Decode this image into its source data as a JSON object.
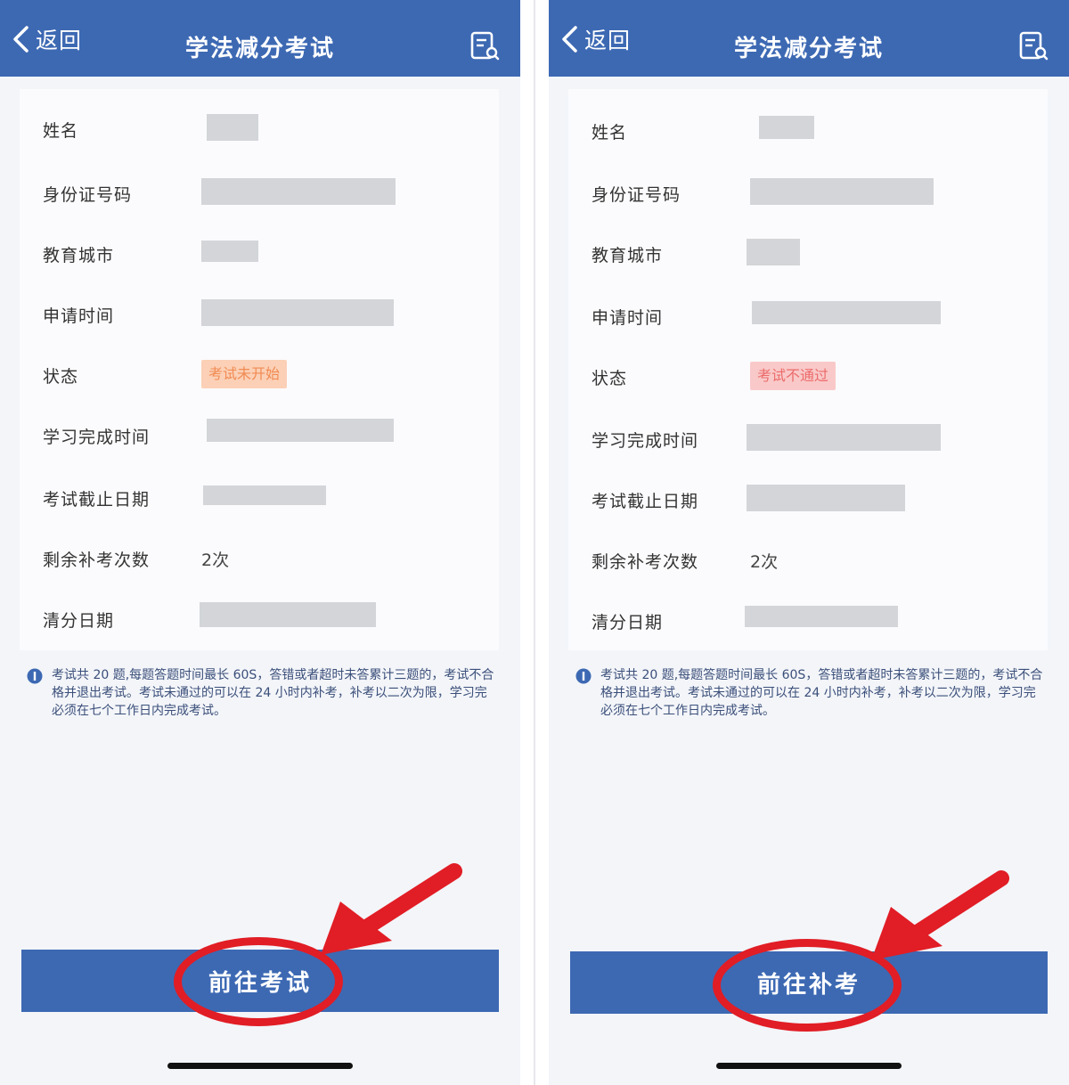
{
  "screens": [
    {
      "nav": {
        "back_label": "返回",
        "title": "学法减分考试",
        "action_icon": "document-search-icon"
      },
      "fields": {
        "name": {
          "label": "姓名"
        },
        "id_number": {
          "label": "身份证号码"
        },
        "city": {
          "label": "教育城市"
        },
        "apply_time": {
          "label": "申请时间"
        },
        "status": {
          "label": "状态",
          "value": "考试未开始",
          "bg": "#fbd0b6",
          "fg": "#f18b53"
        },
        "study_done_time": {
          "label": "学习完成时间"
        },
        "exam_deadline": {
          "label": "考试截止日期"
        },
        "remaining_makeup": {
          "label": "剩余补考次数",
          "value": "2次"
        },
        "clear_date": {
          "label": "清分日期"
        }
      },
      "notice": "考试共 20 题,每题答题时间最长 60S，答错或者超时未答累计三题的，考试不合格并退出考试。考试未通过的可以在 24 小时内补考，补考以二次为限，学习完必须在七个工作日内完成考试。",
      "button_label": "前往考试"
    },
    {
      "nav": {
        "back_label": "返回",
        "title": "学法减分考试",
        "action_icon": "document-search-icon"
      },
      "fields": {
        "name": {
          "label": "姓名"
        },
        "id_number": {
          "label": "身份证号码"
        },
        "city": {
          "label": "教育城市"
        },
        "apply_time": {
          "label": "申请时间"
        },
        "status": {
          "label": "状态",
          "value": "考试不通过",
          "bg": "#f9c9c9",
          "fg": "#ec6b6b"
        },
        "study_done_time": {
          "label": "学习完成时间"
        },
        "exam_deadline": {
          "label": "考试截止日期"
        },
        "remaining_makeup": {
          "label": "剩余补考次数",
          "value": "2次"
        },
        "clear_date": {
          "label": "清分日期"
        }
      },
      "notice": "考试共 20 题,每题答题时间最长 60S，答错或者超时未答累计三题的，考试不合格并退出考试。考试未通过的可以在 24 小时内补考，补考以二次为限，学习完必须在七个工作日内完成考试。",
      "button_label": "前往补考"
    }
  ],
  "colors": {
    "nav_blue": "#3d69b3",
    "annotation_red": "#e11d25",
    "mask_gray": "#d3d5d8"
  }
}
